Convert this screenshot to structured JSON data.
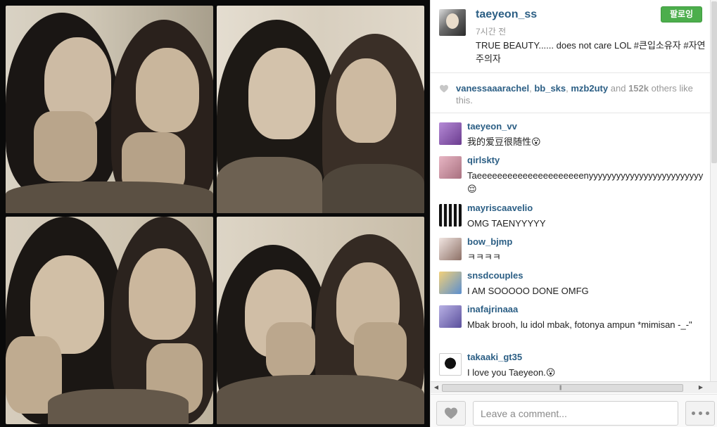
{
  "post": {
    "owner": "taeyeon_ss",
    "time": "7시간 전",
    "caption": "TRUE BEAUTY...... does not care LOL #큰입소유자 #자연주의자",
    "follow_label": "팔로잉",
    "photo_icon": "photobooth-four-panel-image"
  },
  "likes": {
    "users": [
      "vanessaaarachel",
      "bb_sks",
      "mzb2uty"
    ],
    "and_word": "and",
    "count": "152k",
    "suffix": "others like this."
  },
  "comments": [
    {
      "user": "taeyeon_vv",
      "text": "我的爱豆很随性😮"
    },
    {
      "user": "qirlskty",
      "text": "Taeeeeeeeeeeeeeeeeeeeeenyyyyyyyyyyyyyyyyyyyyyyyyy😌"
    },
    {
      "user": "mayriscaavelio",
      "text": "OMG TAENYYYYY"
    },
    {
      "user": "bow_bjmp",
      "text": "ㅋㅋㅋㅋ"
    },
    {
      "user": "snsdcouples",
      "text": "I AM SOOOOO DONE OMFG"
    },
    {
      "user": "inafajrinaaa",
      "text": "Mbak brooh, lu idol mbak, fotonya ampun *mimisan -_-\""
    },
    {
      "user": "takaaki_gt35",
      "text": "I love you Taeyeon.😮"
    }
  ],
  "comment_bar": {
    "placeholder": "Leave a comment...",
    "like_icon": "heart-icon",
    "more_icon": "more-dots-icon"
  },
  "colors": {
    "link": "#2b5e84",
    "follow_green": "#4cae4c",
    "muted": "#999999"
  }
}
